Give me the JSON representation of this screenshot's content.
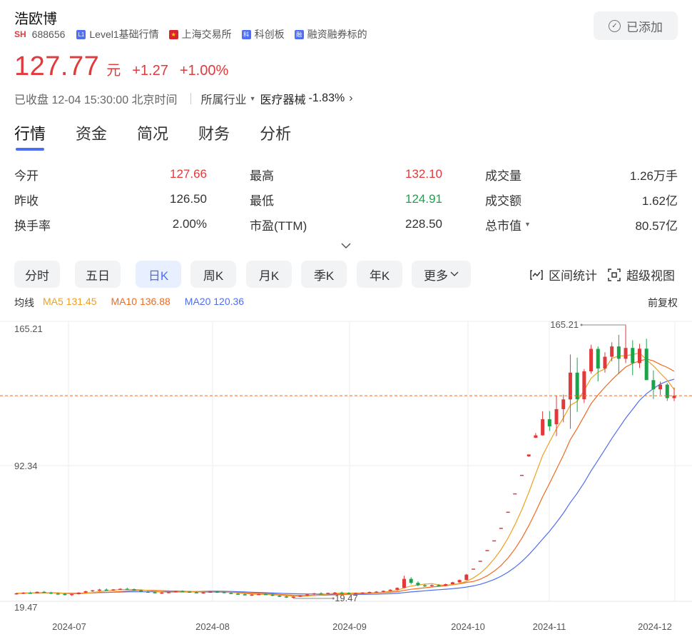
{
  "stock": {
    "name": "浩欧博",
    "market": "SH",
    "code": "688656",
    "tags": [
      {
        "icon": "L1",
        "label": "Level1基础行情"
      },
      {
        "icon": "flag",
        "label": "上海交易所"
      },
      {
        "icon": "科",
        "label": "科创板"
      },
      {
        "icon": "融",
        "label": "融资融券标的"
      }
    ],
    "added_label": "已添加",
    "price": "127.77",
    "unit": "元",
    "change": "+1.27",
    "change_pct": "+1.00%",
    "status": "已收盘 12-04 15:30:00 北京时间",
    "industry_label": "所属行业",
    "industry_name": "医疗器械",
    "industry_change": "-1.83%"
  },
  "tabs": [
    "行情",
    "资金",
    "简况",
    "财务",
    "分析"
  ],
  "stats": [
    [
      {
        "label": "今开",
        "value": "127.66",
        "color": "red"
      },
      {
        "label": "最高",
        "value": "132.10",
        "color": "red"
      },
      {
        "label": "成交量",
        "value": "1.26万手",
        "color": ""
      }
    ],
    [
      {
        "label": "昨收",
        "value": "126.50",
        "color": ""
      },
      {
        "label": "最低",
        "value": "124.91",
        "color": "green"
      },
      {
        "label": "成交额",
        "value": "1.62亿",
        "color": ""
      }
    ],
    [
      {
        "label": "换手率",
        "value": "2.00%",
        "color": ""
      },
      {
        "label": "市盈(TTM)",
        "value": "228.50",
        "color": ""
      },
      {
        "label": "总市值",
        "value": "80.57亿",
        "color": "",
        "dropdown": true
      }
    ]
  ],
  "periods": [
    "分时",
    "五日",
    "日K",
    "周K",
    "月K",
    "季K",
    "年K",
    "更多"
  ],
  "active_period": "日K",
  "tools": {
    "range_stats": "区间统计",
    "super_view": "超级视图"
  },
  "ma": {
    "label": "均线",
    "ma5": "MA5 131.45",
    "ma10": "MA10 136.88",
    "ma20": "MA20 120.36",
    "ma5_color": "#f0a020",
    "ma10_color": "#f06a20",
    "ma20_color": "#4e6ef2"
  },
  "adjust": "前复权",
  "colors": {
    "up": "#e1393c",
    "down": "#1aa34a",
    "accent": "#4e6ef2"
  },
  "chart_data": {
    "type": "candlestick",
    "y_ticks": [
      "165.21",
      "92.34",
      "19.47"
    ],
    "ylim": [
      19.47,
      165.21
    ],
    "x_ticks": [
      "2024-07",
      "2024-08",
      "2024-09",
      "2024-10",
      "2024-11",
      "2024-12"
    ],
    "max_label": "165.21",
    "min_label": "19.47",
    "last_close": 127.77,
    "candles": [
      [
        22,
        22.5,
        21.5,
        22.2
      ],
      [
        22.2,
        22.8,
        21.8,
        22.5
      ],
      [
        22.5,
        23,
        22,
        22.3
      ],
      [
        22.3,
        23.2,
        22.2,
        23
      ],
      [
        23,
        23.5,
        22.4,
        22.6
      ],
      [
        22.6,
        23,
        21.8,
        22.1
      ],
      [
        22.1,
        22.6,
        21.5,
        21.9
      ],
      [
        21.9,
        22.3,
        21,
        21.3
      ],
      [
        21.3,
        22,
        20.8,
        21.8
      ],
      [
        21.8,
        22.8,
        21.6,
        22.6
      ],
      [
        22.6,
        23.6,
        22.4,
        23.3
      ],
      [
        23.3,
        24,
        23,
        23.8
      ],
      [
        23.8,
        24.6,
        23.4,
        24.2
      ],
      [
        24.2,
        24.8,
        23.6,
        23.9
      ],
      [
        23.9,
        24.5,
        23.5,
        24.3
      ],
      [
        24.3,
        24.9,
        23.9,
        24.6
      ],
      [
        24.6,
        25.2,
        24.2,
        24.4
      ],
      [
        24.4,
        24.8,
        23.6,
        23.8
      ],
      [
        23.8,
        24.2,
        22.8,
        23.1
      ],
      [
        23.1,
        23.6,
        22.5,
        22.8
      ],
      [
        22.8,
        23.2,
        22.1,
        22.4
      ],
      [
        22.4,
        22.9,
        21.9,
        22.6
      ],
      [
        22.6,
        23,
        22.2,
        22.9
      ],
      [
        22.9,
        23.6,
        22.6,
        23.4
      ],
      [
        23.4,
        23.8,
        22.9,
        23.1
      ],
      [
        23.1,
        23.5,
        22.6,
        22.8
      ],
      [
        22.8,
        23.2,
        22.3,
        22.5
      ],
      [
        22.5,
        22.9,
        22,
        22.7
      ],
      [
        22.7,
        23.3,
        22.5,
        23.1
      ],
      [
        23.1,
        23.5,
        22.7,
        22.9
      ],
      [
        22.9,
        23.2,
        22.2,
        22.4
      ],
      [
        22.4,
        22.8,
        21.8,
        22
      ],
      [
        22,
        22.4,
        21.5,
        21.7
      ],
      [
        21.7,
        22.1,
        21,
        21.3
      ],
      [
        21.3,
        21.8,
        20.8,
        21.5
      ],
      [
        21.5,
        22,
        21.2,
        21.8
      ],
      [
        21.8,
        22.2,
        21.3,
        21.5
      ],
      [
        21.5,
        21.9,
        20.6,
        20.9
      ],
      [
        20.9,
        21.3,
        20.2,
        20.5
      ],
      [
        20.5,
        20.9,
        19.8,
        20.1
      ],
      [
        20.1,
        20.7,
        19.47,
        20.4
      ],
      [
        20.4,
        21.2,
        20.2,
        21
      ],
      [
        21,
        21.8,
        20.8,
        21.6
      ],
      [
        21.6,
        22.4,
        21.4,
        22.2
      ],
      [
        22.2,
        22.8,
        21.8,
        22
      ],
      [
        22,
        22.6,
        21.7,
        22.4
      ],
      [
        22.4,
        22.9,
        22,
        22.6
      ],
      [
        22.6,
        23.1,
        22.2,
        22.4
      ],
      [
        22.4,
        22.8,
        21.9,
        22.1
      ],
      [
        22.1,
        22.6,
        21.8,
        22.3
      ],
      [
        22.3,
        22.8,
        21.9,
        22.6
      ],
      [
        22.6,
        23.2,
        22.3,
        22.9
      ],
      [
        22.9,
        23.4,
        22.5,
        23.1
      ],
      [
        23.1,
        23.8,
        22.8,
        23.5
      ],
      [
        23.5,
        24.4,
        23.2,
        24.1
      ],
      [
        24.1,
        25.4,
        23.8,
        25.1
      ],
      [
        25.1,
        31.6,
        24.8,
        29.9
      ],
      [
        29.9,
        30.8,
        27,
        27.8
      ],
      [
        27.8,
        28.6,
        26,
        26.5
      ],
      [
        26.5,
        27.3,
        25.6,
        26.2
      ],
      [
        26.2,
        27,
        25.7,
        26.6
      ],
      [
        26.6,
        27.2,
        26,
        26.3
      ],
      [
        26.3,
        27.4,
        26,
        27.1
      ],
      [
        27.1,
        28.4,
        26.9,
        28.1
      ],
      [
        28.1,
        29.6,
        27.8,
        29.3
      ],
      [
        29.3,
        32.6,
        29.1,
        32.2
      ],
      [
        35.4,
        35.4,
        35.4,
        35.4
      ],
      [
        39.6,
        39.6,
        39.6,
        39.6
      ],
      [
        45.3,
        45.3,
        45.3,
        45.3
      ],
      [
        50.5,
        50.5,
        50.5,
        50.5
      ],
      [
        57.2,
        57.2,
        57.2,
        57.2
      ],
      [
        65.8,
        65.8,
        65.8,
        65.8
      ],
      [
        75.6,
        75.6,
        75.6,
        75.6
      ],
      [
        85.5,
        85.5,
        85.5,
        85.5
      ],
      [
        95.4,
        96.4,
        95.1,
        96.4
      ],
      [
        105.3,
        107.8,
        105.2,
        106.6
      ],
      [
        106.6,
        119.4,
        106.4,
        115.2
      ],
      [
        115.2,
        119.6,
        109,
        111.4
      ],
      [
        112.5,
        127.7,
        106.2,
        120.6
      ],
      [
        120.6,
        128.4,
        113.6,
        125.8
      ],
      [
        125.8,
        149.8,
        110.1,
        140.1
      ],
      [
        140.1,
        148.1,
        119.1,
        125.9
      ],
      [
        125.9,
        142,
        123.8,
        140.8
      ],
      [
        140.8,
        155,
        139.6,
        152.8
      ],
      [
        152.8,
        154.1,
        135.4,
        142.3
      ],
      [
        142.3,
        151,
        140.1,
        148.6
      ],
      [
        148.6,
        156.3,
        146.1,
        154.1
      ],
      [
        154.1,
        160.3,
        139.4,
        147.5
      ],
      [
        147.5,
        165.21,
        145.2,
        153.3
      ],
      [
        153.3,
        157.4,
        138.7,
        145.2
      ],
      [
        145.2,
        155.5,
        142.6,
        152.9
      ],
      [
        152.9,
        158.2,
        140,
        136.1
      ],
      [
        136.1,
        141.3,
        126,
        131.2
      ],
      [
        131.2,
        135.4,
        128.2,
        133.7
      ],
      [
        133.7,
        134.5,
        125,
        126.5
      ],
      [
        126.5,
        132.1,
        124.91,
        127.77
      ]
    ]
  }
}
